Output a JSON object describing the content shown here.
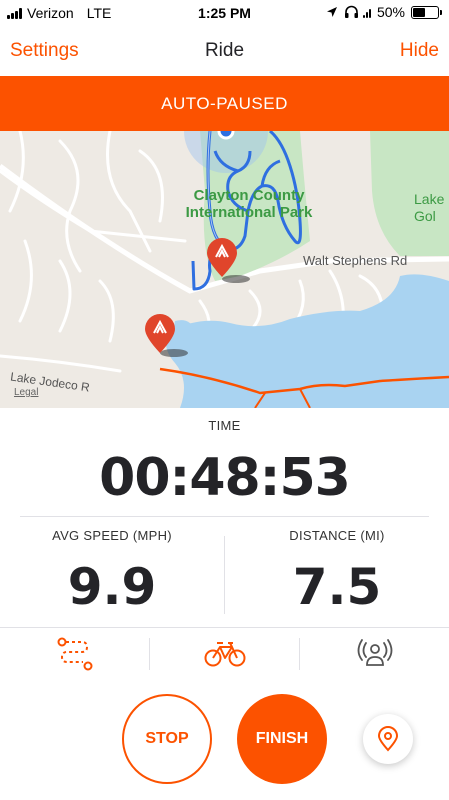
{
  "colors": {
    "accent": "#fc5200",
    "route": "#2f6fe0",
    "park": "#c8e6c4",
    "water": "#a9d3f1",
    "land": "#eeeae4"
  },
  "status_bar": {
    "carrier": "Verizon",
    "network": "LTE",
    "time": "1:25 PM",
    "battery": "50%",
    "battery_level": 0.5
  },
  "nav": {
    "left": "Settings",
    "title": "Ride",
    "right": "Hide"
  },
  "banner": {
    "text": "AUTO-PAUSED"
  },
  "map": {
    "park_label": "Clayton County International Park",
    "road_label": "Walt Stephens Rd",
    "lake_label": "Lake Gol",
    "lake2_label": "Lake Jodeco R",
    "legal": "Legal"
  },
  "stats": {
    "time": {
      "label": "TIME",
      "value": "00:48:53"
    },
    "avg_speed": {
      "label": "AVG SPEED (MPH)",
      "value": "9.9"
    },
    "distance": {
      "label": "DISTANCE (MI)",
      "value": "7.5"
    }
  },
  "icons": {
    "route": "route-icon",
    "bike": "bike-icon",
    "sensor": "sensor-icon",
    "locate": "location-pin-icon"
  },
  "buttons": {
    "stop": "STOP",
    "finish": "FINISH"
  }
}
